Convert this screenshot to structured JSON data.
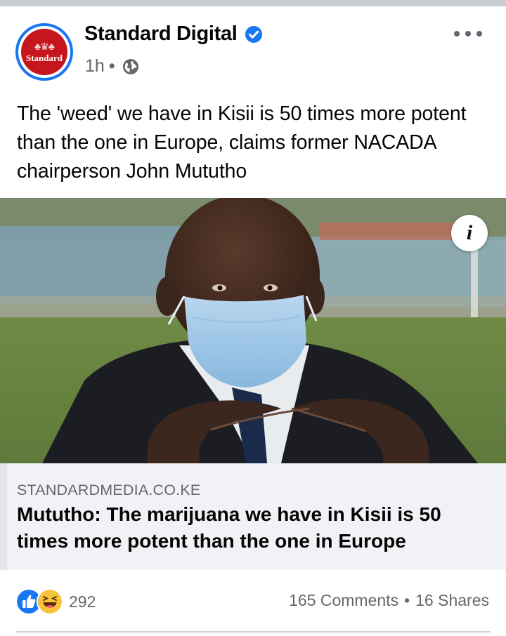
{
  "post": {
    "page_name": "Standard Digital",
    "avatar_text": "Standard",
    "time_ago": "1h",
    "separator": "•",
    "caption": "The 'weed' we have in Kisii is 50 times more potent than the one in Europe, claims former NACADA chairperson John Mututho"
  },
  "link_preview": {
    "domain": "STANDARDMEDIA.CO.KE",
    "headline": "Mututho: The marijuana we have in Kisii is 50 times more potent than the one in Europe",
    "info_glyph": "i"
  },
  "footer": {
    "reaction_count": "292",
    "comments": "165 Comments",
    "separator": "•",
    "shares": "16 Shares"
  },
  "icons": {
    "verified": "verified-badge-icon",
    "privacy": "globe-icon",
    "menu": "more-options-icon",
    "reactions": [
      "like-icon",
      "haha-icon"
    ]
  },
  "colors": {
    "brand_blue": "#1877f2",
    "standard_red": "#c4161c",
    "meta_gray": "#65676b",
    "preview_bg": "#f0f2f5"
  }
}
